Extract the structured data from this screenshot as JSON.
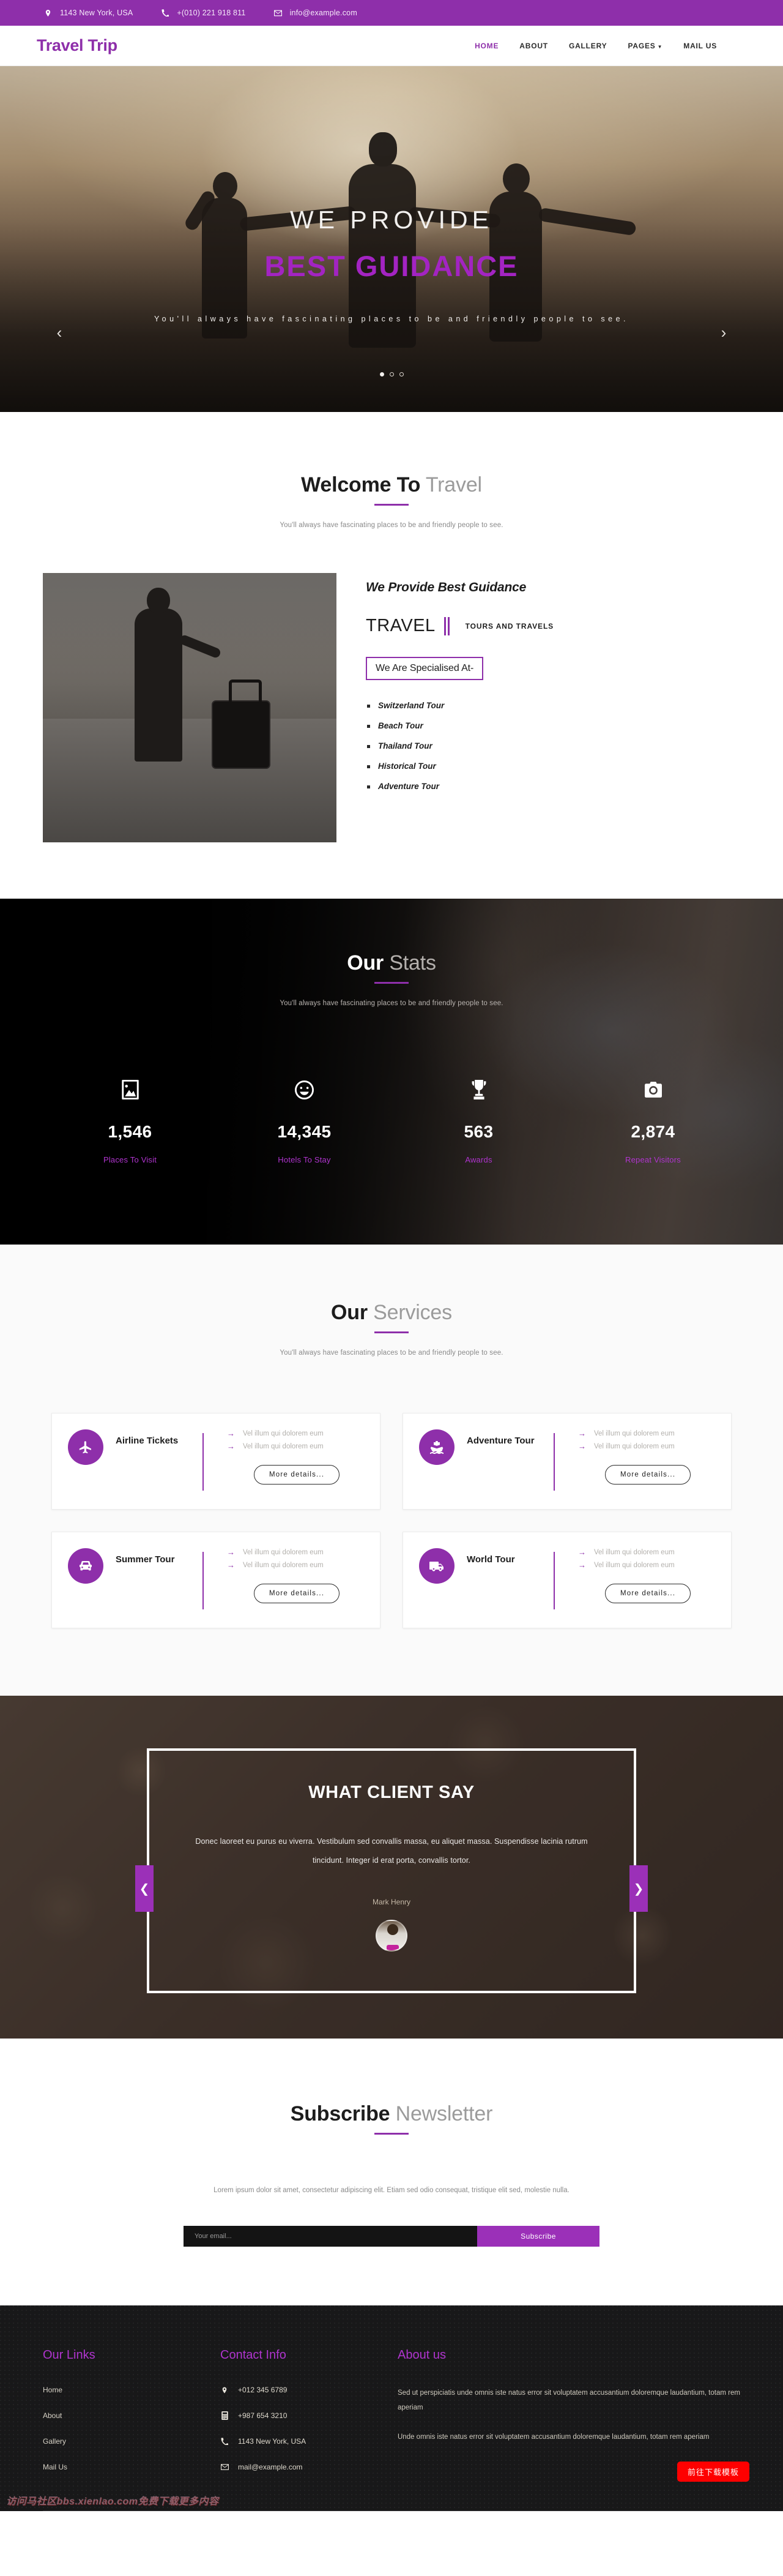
{
  "topbar": {
    "items": [
      {
        "icon": "location-pin-icon",
        "text": "1143 New York, USA"
      },
      {
        "icon": "phone-icon",
        "text": "+(010) 221 918 811"
      },
      {
        "icon": "mail-icon",
        "text": "info@example.com"
      }
    ]
  },
  "nav": {
    "logo": "Travel Trip",
    "items": [
      {
        "label": "HOME",
        "active": true
      },
      {
        "label": "ABOUT",
        "active": false
      },
      {
        "label": "GALLERY",
        "active": false
      },
      {
        "label": "PAGES",
        "active": false,
        "caret": "▼"
      },
      {
        "label": "MAIL US",
        "active": false
      }
    ]
  },
  "hero": {
    "line1": "WE PROVIDE",
    "line2": "BEST GUIDANCE",
    "subtitle": "You'll always have fascinating places to be and friendly people to see.",
    "prev": "‹",
    "next": "›",
    "slides": 3,
    "active_slide": 1
  },
  "welcome": {
    "heading_bold": "Welcome To",
    "heading_light": "Travel",
    "subtitle": "You'll always have fascinating places to be and friendly people to see.",
    "title": "We Provide Best Guidance",
    "brand": "TRAVEL",
    "brand_sub": "TOURS AND TRAVELS",
    "badge": "We Are Specialised At-",
    "list": [
      "Switzerland Tour",
      "Beach Tour",
      "Thailand Tour",
      "Historical Tour",
      "Adventure Tour"
    ]
  },
  "stats": {
    "heading_bold": "Our",
    "heading_light": "Stats",
    "subtitle": "You'll always have fascinating places to be and friendly people to see.",
    "items": [
      {
        "icon": "image-icon",
        "value": "1,546",
        "label": "Places To Visit"
      },
      {
        "icon": "smiley-icon",
        "value": "14,345",
        "label": "Hotels To Stay"
      },
      {
        "icon": "trophy-icon",
        "value": "563",
        "label": "Awards"
      },
      {
        "icon": "camera-icon",
        "value": "2,874",
        "label": "Repeat Visitors"
      }
    ]
  },
  "services": {
    "heading_bold": "Our",
    "heading_light": "Services",
    "subtitle": "You'll always have fascinating places to be and friendly people to see.",
    "button_label": "More details...",
    "bullet": "→",
    "cards": [
      {
        "icon": "airplane-icon",
        "name": "Airline Tickets",
        "items": [
          "Vel illum qui dolorem eum",
          "Vel illum qui dolorem eum"
        ]
      },
      {
        "icon": "ship-icon",
        "name": "Adventure Tour",
        "items": [
          "Vel illum qui dolorem eum",
          "Vel illum qui dolorem eum"
        ]
      },
      {
        "icon": "car-icon",
        "name": "Summer Tour",
        "items": [
          "Vel illum qui dolorem eum",
          "Vel illum qui dolorem eum"
        ]
      },
      {
        "icon": "truck-icon",
        "name": "World Tour",
        "items": [
          "Vel illum qui dolorem eum",
          "Vel illum qui dolorem eum"
        ]
      }
    ]
  },
  "testimonial": {
    "title": "WHAT CLIENT SAY",
    "quote": "Donec laoreet eu purus eu viverra. Vestibulum sed convallis massa, eu aliquet massa. Suspendisse lacinia rutrum tincidunt. Integer id erat porta, convallis tortor.",
    "author": "Mark Henry",
    "prev": "❮",
    "next": "❯"
  },
  "subscribe": {
    "heading_bold": "Subscribe",
    "heading_light": "Newsletter",
    "copy": "Lorem ipsum dolor sit amet, consectetur adipiscing elit. Etiam sed odio consequat, tristique elit sed, molestie nulla.",
    "placeholder": "Your email...",
    "button": "Subscribe"
  },
  "footer": {
    "links_heading": "Our Links",
    "links": [
      "Home",
      "About",
      "Gallery",
      "Mail Us"
    ],
    "contact_heading": "Contact Info",
    "contact": [
      {
        "icon": "location-pin-icon",
        "text": "+012 345 6789"
      },
      {
        "icon": "fax-icon",
        "text": "+987 654 3210"
      },
      {
        "icon": "phone-icon",
        "text": "1143 New York, USA"
      },
      {
        "icon": "mail-icon",
        "text": "mail@example.com"
      }
    ],
    "about_heading": "About us",
    "about": [
      "Sed ut perspiciatis unde omnis iste natus error sit voluptatem accusantium doloremque laudantium, totam rem aperiam",
      "Unde omnis iste natus error sit voluptatem accusantium doloremque laudantium, totam rem aperiam"
    ],
    "download_badge": "前往下载模板",
    "watermark": "访问马社区bbs.xienlao.com免费下载更多内容"
  },
  "colors": {
    "brand": "#8e2faa",
    "brand_light": "#b034cf",
    "dark": "#181819",
    "badge_red": "#fe0000"
  }
}
